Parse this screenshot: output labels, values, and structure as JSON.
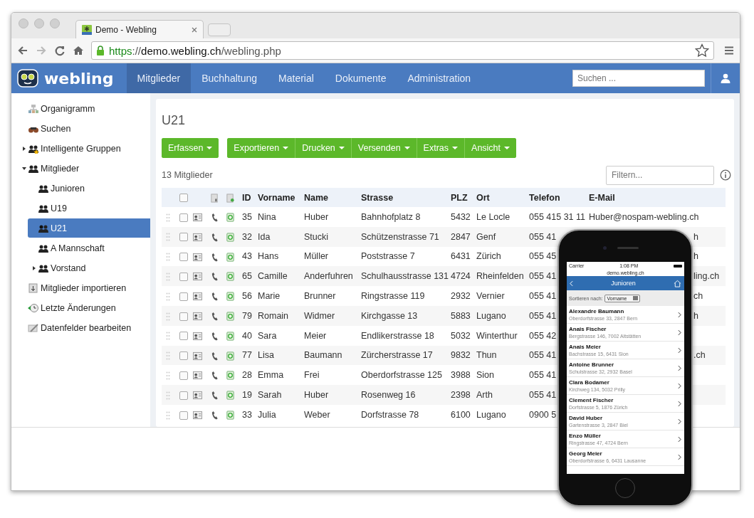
{
  "browser": {
    "tab_title": "Demo - Webling",
    "url": {
      "scheme": "https",
      "separator": "://",
      "host": "demo.webling.ch",
      "path": "/webling.php"
    }
  },
  "app": {
    "logo": "webling",
    "nav": [
      {
        "label": "Mitglieder",
        "selected": true
      },
      {
        "label": "Buchhaltung",
        "selected": false
      },
      {
        "label": "Material",
        "selected": false
      },
      {
        "label": "Dokumente",
        "selected": false
      },
      {
        "label": "Administration",
        "selected": false
      }
    ],
    "search": {
      "placeholder": "Suchen ..."
    }
  },
  "sidebar": {
    "items": [
      {
        "label": "Organigramm",
        "kind": "org",
        "selected": false
      },
      {
        "label": "Suchen",
        "kind": "search",
        "selected": false
      },
      {
        "label": "Intelligente Gruppen",
        "kind": "smart",
        "selected": false,
        "expanded": false
      },
      {
        "label": "Mitglieder",
        "kind": "group",
        "selected": false,
        "expanded": true,
        "children": [
          {
            "label": "Junioren",
            "kind": "group",
            "selected": false
          },
          {
            "label": "U19",
            "kind": "group",
            "selected": false
          },
          {
            "label": "U21",
            "kind": "group",
            "selected": true
          },
          {
            "label": "A Mannschaft",
            "kind": "group",
            "selected": false
          },
          {
            "label": "Vorstand",
            "kind": "group",
            "selected": false,
            "expanded": false
          }
        ]
      },
      {
        "label": "Mitglieder importieren",
        "kind": "import",
        "selected": false
      },
      {
        "label": "Letzte Änderungen",
        "kind": "history",
        "selected": false
      },
      {
        "label": "Datenfelder bearbeiten",
        "kind": "fields",
        "selected": false
      }
    ]
  },
  "main": {
    "title": "U21",
    "toolbar": [
      [
        "Erfassen"
      ],
      [
        "Exportieren",
        "Drucken",
        "Versenden",
        "Extras",
        "Ansicht"
      ]
    ],
    "count": "13 Mitglieder",
    "filter": {
      "placeholder": "Filtern..."
    },
    "table": {
      "header_checked": false,
      "columns": [
        "ID",
        "Vorname",
        "Name",
        "Strasse",
        "PLZ",
        "Ort",
        "Telefon",
        "E-Mail"
      ],
      "rows": [
        {
          "checked": false,
          "cells": [
            "35",
            "Nina",
            "Huber",
            "Bahnhofplatz 8",
            "5432",
            "Le Locle",
            "055 415 31 11",
            "Huber@nospam-webling.ch"
          ]
        },
        {
          "checked": false,
          "cells": [
            "32",
            "Ida",
            "Stucki",
            "Schützenstrasse 71",
            "2847",
            "Genf",
            "055 41",
            "h"
          ]
        },
        {
          "checked": false,
          "cells": [
            "43",
            "Hans",
            "Müller",
            "Poststrasse 7",
            "6431",
            "Zürich",
            "055 45",
            "h"
          ]
        },
        {
          "checked": false,
          "cells": [
            "65",
            "Camille",
            "Anderfuhren",
            "Schulhausstrasse 131",
            "4724",
            "Rheinfelden",
            "055 41",
            "ling.ch"
          ]
        },
        {
          "checked": false,
          "cells": [
            "56",
            "Marie",
            "Brunner",
            "Ringstrasse 119",
            "2932",
            "Vernier",
            "055 41",
            "ch"
          ]
        },
        {
          "checked": false,
          "cells": [
            "79",
            "Romain",
            "Widmer",
            "Kirchgasse 13",
            "5883",
            "Lugano",
            "055 41",
            "h"
          ]
        },
        {
          "checked": false,
          "cells": [
            "40",
            "Sara",
            "Meier",
            "Endlikerstrasse 18",
            "5032",
            "Winterthur",
            "055 42",
            ""
          ]
        },
        {
          "checked": false,
          "cells": [
            "77",
            "Lisa",
            "Baumann",
            "Zürcherstrasse 17",
            "9832",
            "Thun",
            "055 41",
            ".ch"
          ]
        },
        {
          "checked": false,
          "cells": [
            "28",
            "Emma",
            "Frei",
            "Oberdorfstrasse 125",
            "3988",
            "Sion",
            "055 41",
            ""
          ]
        },
        {
          "checked": false,
          "cells": [
            "19",
            "Sarah",
            "Huber",
            "Rosenweg 16",
            "2398",
            "Arth",
            "055 41",
            ""
          ]
        },
        {
          "checked": false,
          "cells": [
            "33",
            "Julia",
            "Weber",
            "Dorfstrasse 78",
            "6100",
            "Lugano",
            "0900 5",
            ""
          ]
        }
      ]
    }
  },
  "phone": {
    "carrier": "Carrier",
    "time": "1:08 PM",
    "url": "demo.webling.ch",
    "title": "Junioren",
    "sort_label": "Sortieren nach:",
    "sort_value": "Vorname",
    "items": [
      {
        "name": "Alexandre Baumann",
        "address": "Oberdorfstrasse 33, 2847 Bern"
      },
      {
        "name": "Anais Fischer",
        "address": "Bergstrasse 146, 7002 Altstätten"
      },
      {
        "name": "Anais Meier",
        "address": "Bachstrasse 15, 6431 Sion"
      },
      {
        "name": "Antoine Brunner",
        "address": "Schulstrasse 32, 2932 Basel"
      },
      {
        "name": "Clara Bodamer",
        "address": "Kirchweg 134, 5032 Prilly"
      },
      {
        "name": "Clement Fischer",
        "address": "Dorfstrasse 5, 1876 Zürich"
      },
      {
        "name": "David Huber",
        "address": "Gartenstrasse 3, 2847 Biel"
      },
      {
        "name": "Enzo Müller",
        "address": "Ringstrasse 47, 4724 Bern"
      },
      {
        "name": "Georg Meier",
        "address": "Oberdorfstrasse 6, 6431 Lausanne"
      }
    ]
  }
}
